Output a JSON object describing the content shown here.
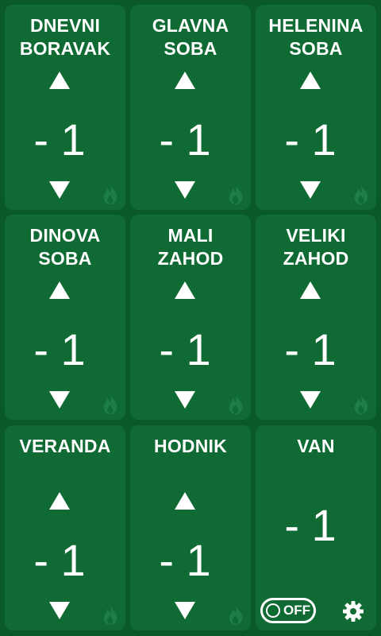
{
  "rooms": [
    {
      "name": "DNEVNI\nBORAVAK",
      "temp": "- 1"
    },
    {
      "name": "GLAVNA\nSOBA",
      "temp": "- 1"
    },
    {
      "name": "HELENINA\nSOBA",
      "temp": "- 1"
    },
    {
      "name": "DINOVA\nSOBA",
      "temp": "- 1"
    },
    {
      "name": "MALI\nZAHOD",
      "temp": "- 1"
    },
    {
      "name": "VELIKI\nZAHOD",
      "temp": "- 1"
    },
    {
      "name": "VERANDA",
      "temp": "- 1"
    },
    {
      "name": "HODNIK",
      "temp": "- 1"
    }
  ],
  "outside": {
    "name": "VAN",
    "temp": "- 1",
    "toggle_label": "OFF"
  },
  "icons": {
    "up": "up-arrow-icon",
    "down": "down-arrow-icon",
    "flame": "flame-icon",
    "settings": "gear-icon"
  },
  "colors": {
    "background": "#0a5a28",
    "tile": "#0f6b33",
    "flame_inactive": "#1d7f45"
  }
}
